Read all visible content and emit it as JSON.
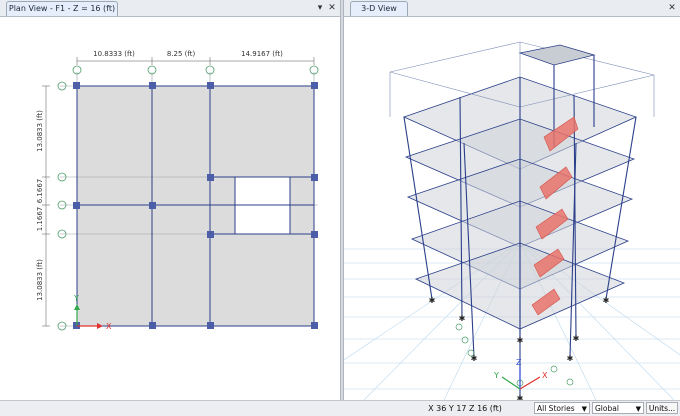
{
  "left_pane": {
    "tab_title": "Plan View - F1 - Z = 16 (ft)",
    "menu_icon": "dropdown-arrow",
    "close_icon": "close-x",
    "dimensions_top": [
      "10.8333 (ft)",
      "8.25 (ft)",
      "14.9167 (ft)"
    ],
    "dimensions_left": [
      "13.0833 (ft)",
      "6.1667",
      "1.1667",
      "13.0833 (ft)"
    ],
    "axis_labels": {
      "x": "X",
      "y": "Y"
    }
  },
  "right_pane": {
    "tab_title": "3-D View",
    "close_icon": "close-x",
    "axis_labels": {
      "x": "X",
      "y": "Y",
      "z": "Z"
    }
  },
  "status": {
    "coords": "X 36  Y 17  Z 16 (ft)",
    "stories_select": "All Stories",
    "coord_system_select": "Global",
    "units_button": "Units..."
  },
  "colors": {
    "slab": "#dcdcdc",
    "frame": "#2b3f8a",
    "column_marker": "#4c5ea8",
    "grid": "#4f9e6a",
    "stair": "#e8736b",
    "axis_x": "#e03030",
    "axis_y": "#2ea84a",
    "axis_z": "#2f4fd6"
  }
}
